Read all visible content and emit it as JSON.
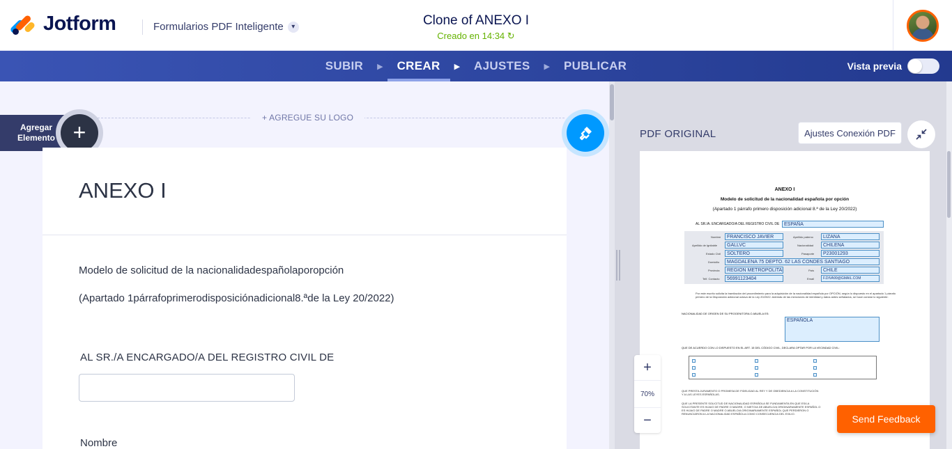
{
  "header": {
    "brand": "Jotform",
    "product": "Formularios PDF Inteligente",
    "form_title": "Clone of ANEXO I",
    "saved_status": "Creado en 14:34"
  },
  "nav": {
    "steps": [
      {
        "label": "SUBIR",
        "active": false
      },
      {
        "label": "CREAR",
        "active": true
      },
      {
        "label": "AJUSTES",
        "active": false
      },
      {
        "label": "PUBLICAR",
        "active": false
      }
    ],
    "preview_label": "Vista previa"
  },
  "builder": {
    "add_element_label": "Agregar Elemento",
    "logo_hint": "+ AGREGUE SU LOGO",
    "form_heading": "ANEXO I",
    "paragraph_1": "Modelo de solicitud de la nacionalidadespañolaporopción",
    "paragraph_2": "(Apartado 1párrafoprimerodisposiciónadicional8.ªde la Ley 20/2022)",
    "field_label_1": "AL SR./A ENCARGADO/A DEL REGISTRO CIVIL DE",
    "field_input_1_value": "",
    "field_label_2": "Nombre"
  },
  "pdf_panel": {
    "title": "PDF ORIGINAL",
    "settings_button": "Ajustes Conexión PDF",
    "zoom": "70%",
    "page": {
      "heading": "ANEXO I",
      "subtitle": "Modelo de solicitud de la nacionalidad española por opción",
      "subtitle_2": "(Apartado 1 párrafo primero disposición adicional 8.ª de la Ley 20/2022)",
      "registro_label": "AL SR./A. ENCARGADO/A DEL REGISTRO CIVIL DE",
      "registro_value": "ESPAÑA",
      "fields": [
        {
          "label": "Nombre",
          "value": "FRANCISCO JAVIER"
        },
        {
          "label": "Apellido de Ignitable",
          "value": "GALLVC"
        },
        {
          "label": "Estado Civil",
          "value": "SOLTERO"
        },
        {
          "label": "Domicilio",
          "value": "MAGDALENA 75 DEPTO. 62 LAS CONDES SANTIAGO"
        },
        {
          "label": "Provincia",
          "value": "REGION METROPOLITANA"
        },
        {
          "label": "Telf. Contacto",
          "value": "56991123404"
        }
      ],
      "fields_right": [
        {
          "label": "Apellido paterno",
          "value": "LIZANA"
        },
        {
          "label": "Nacionalidad",
          "value": "CHILENA"
        },
        {
          "label": "Pasaporte",
          "value": "P23001293"
        },
        {
          "label": "País",
          "value": "CHILE"
        },
        {
          "label": "Email",
          "value": "F.DIVA99@GMAIL.COM"
        }
      ],
      "nacionalidad_label": "NACIONALIDAD DE ORIGEN DE SU PROGENITORA O ABUELA ES:",
      "nacionalidad_value": "ESPAÑOLA",
      "vecindad_label": "QUE DE ACUERDO CON LO DISPUESTO EN EL ART. 15 DEL CÓDIGO CIVIL, DECLARA OPTAR POR LA VECINDAD CIVIL:",
      "juramento_text": "QUE PRESTA JURAMENTO O PROMESA DE FIDELIDAD AL REY Y DE OBEDIENCIA A LA CONSTITUCIÓN Y A LAS LEYES ESPAÑOLAS.",
      "fundamento_text": "QUE LA PRESENTE SOLICITUD DE NACIONALIDAD ESPAÑOLA SE FUNDAMENTA EN QUE ES/LA SOLICITANTE ES HIJA/O DE PADRE O MADRE, O NIETO/A DE ABUELO/A ORIGINARIAMENTE ESPAÑOL O ES HIJA/O DE PADRE O MADRE O ABUELO/A ORIGINARIAMENTE ESPAÑOL QUE PERDIERON O RENUNCIARON A LA NACIONALIDAD ESPAÑOLA COMO CONSECUENCIA DEL EXILIO."
    }
  },
  "feedback_button": "Send Feedback",
  "colors": {
    "accent": "#0099ff",
    "brand_orange": "#ff6100",
    "navbar": "#2e48a6",
    "saved_green": "#64b200"
  }
}
